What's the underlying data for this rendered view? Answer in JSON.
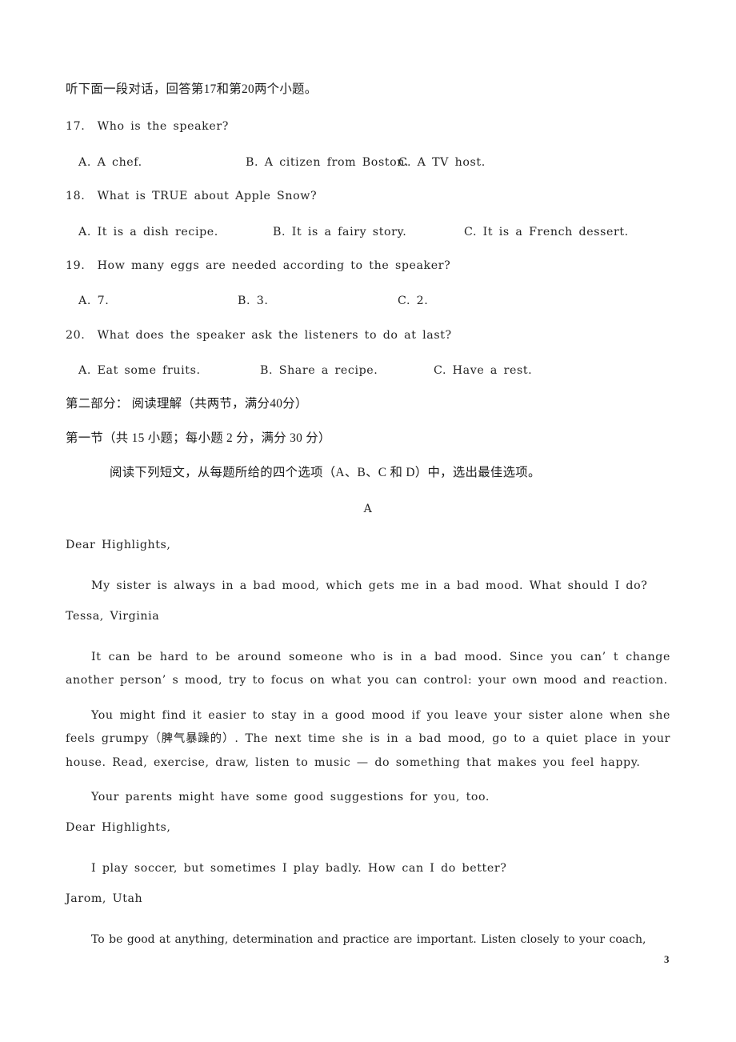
{
  "document": {
    "page_number": "3",
    "listening_instruction": "听下面一段对话，回答第17和第20两个小题。",
    "questions": [
      {
        "number": "17.",
        "stem": "17.  Who is the speaker?",
        "options": [
          {
            "label": "A. A chef."
          },
          {
            "label": "B. A citizen from Boston."
          },
          {
            "label": "C. A TV host."
          }
        ]
      },
      {
        "number": "18.",
        "stem": "18.  What is TRUE about Apple Snow?",
        "options": [
          {
            "label": "A. It is a dish recipe."
          },
          {
            "label": "B. It is a fairy story."
          },
          {
            "label": "C. It is a French dessert."
          }
        ]
      },
      {
        "number": "19.",
        "stem": "19.  How many eggs are needed according to the speaker?",
        "options": [
          {
            "label": "A. 7."
          },
          {
            "label": "B. 3."
          },
          {
            "label": "C. 2."
          }
        ]
      },
      {
        "number": "20.",
        "stem": "20.  What does the speaker ask the listeners to do at last?",
        "options": [
          {
            "label": "A. Eat some fruits."
          },
          {
            "label": "B. Share a recipe."
          },
          {
            "label": "C. Have a rest."
          }
        ]
      }
    ],
    "part_two_heading": "第二部分： 阅读理解（共两节，满分40分）",
    "section_one_heading": "第一节（共 15 小题；每小题 2 分，满分 30 分）",
    "section_one_instruction": "阅读下列短文，从每题所给的四个选项（A、B、C 和 D）中，选出最佳选项。",
    "passage": {
      "title": "A",
      "salutation_1": "Dear Highlights,",
      "paragraph_1": "My sister is always in a bad mood, which gets me in a bad mood. What should I do?",
      "signature_1": "Tessa, Virginia",
      "paragraph_2": "It can be hard to be around someone who is in a bad mood. Since you can’ t change another person’ s mood, try to focus on what you can control: your own mood and reaction.",
      "paragraph_3": "You might find it easier to stay in a good mood if you leave your sister alone when she feels grumpy（脾气暴躁的）. The next time she is in a bad mood, go to a quiet place in your house. Read, exercise, draw, listen to music — do something that makes you feel happy.",
      "paragraph_4": "Your parents might have some good suggestions for you, too.",
      "salutation_2": "Dear Highlights,",
      "paragraph_5": "I play soccer, but sometimes I play badly. How can I do better?",
      "signature_2": "Jarom, Utah",
      "paragraph_6": "To be good at anything, determination and practice are important. Listen closely to your coach,"
    }
  }
}
